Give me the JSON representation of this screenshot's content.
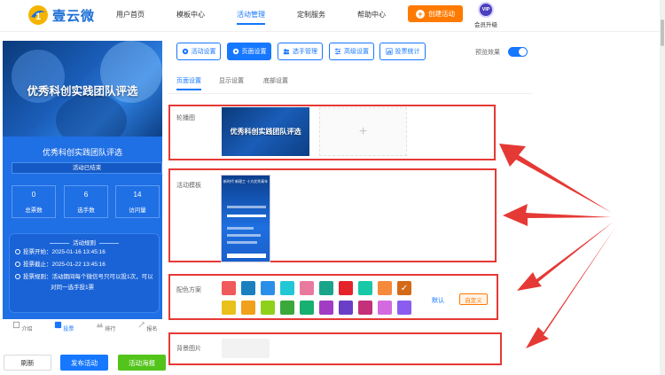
{
  "brand": {
    "name": "壹云微"
  },
  "nav": {
    "items": [
      {
        "label": "用户首页"
      },
      {
        "label": "模板中心"
      },
      {
        "label": "活动管理"
      },
      {
        "label": "定制服务"
      },
      {
        "label": "帮助中心"
      }
    ],
    "active_index": 2,
    "create_button": "创建活动",
    "vip_badge": "VIP",
    "vip_label": "会员升级"
  },
  "preview": {
    "banner_title": "优秀科创实践团队评选",
    "activity_title": "优秀科创实践团队评选",
    "status": "活动已结束",
    "stats": [
      {
        "value": "0",
        "label": "总票数"
      },
      {
        "value": "6",
        "label": "选手数"
      },
      {
        "value": "14",
        "label": "访问量"
      }
    ],
    "rules_heading": "活动规则",
    "rules": [
      "投票开始：2025-01-16 13:45:16",
      "投票截止：2025-01-22 13:45:16",
      "投票规则：活动期间每个微信号只可以投1次，可以",
      "对同一选手投1票"
    ],
    "bottom_tabs": [
      {
        "label": "介绍",
        "icon": "home-icon"
      },
      {
        "label": "投票",
        "icon": "vote-icon"
      },
      {
        "label": "排行",
        "icon": "rank-icon"
      },
      {
        "label": "报名",
        "icon": "signup-icon"
      }
    ],
    "active_tab": 1
  },
  "actions": {
    "refresh": "刷新",
    "publish": "发布活动",
    "poster": "活动海报"
  },
  "toolbar": {
    "tabs": [
      {
        "label": "活动设置",
        "icon": "gear-icon"
      },
      {
        "label": "页面设置",
        "icon": "gear-icon"
      },
      {
        "label": "选手管理",
        "icon": "users-icon"
      },
      {
        "label": "高级设置",
        "icon": "sliders-icon"
      },
      {
        "label": "投票统计",
        "icon": "bar-chart-icon"
      }
    ],
    "active_index": 1,
    "preview_label": "预览效果",
    "preview_on": true
  },
  "subtabs": {
    "items": [
      "页面设置",
      "显示设置",
      "底部设置"
    ],
    "active_index": 0
  },
  "sections": {
    "carousel_label": "轮播图",
    "carousel_image_title": "优秀科创实践团队评选",
    "add_symbol": "+",
    "template_label": "活动模板",
    "template_thumb_title": "新时代 新理工\n十大优秀青年",
    "color_label": "配色方案",
    "default_label": "默认",
    "custom_label": "自定义",
    "bg_label": "背景图片"
  },
  "colors": {
    "row1": [
      "#f05a5a",
      "#1a7fbf",
      "#2b8fe8",
      "#22c7d6",
      "#e87aa0",
      "#1aa38b",
      "#e5232a",
      "#17c9a6",
      "#f58a3c",
      "#d46a17"
    ],
    "row2": [
      "#e8c21a",
      "#f0a01a",
      "#8fd11a",
      "#3aa83a",
      "#17b070",
      "#a33cc4",
      "#6a3fc8",
      "#c4307a",
      "#d46ae0",
      "#8a5cf0"
    ],
    "selected": "#d46a17",
    "accent": "#1677ff",
    "annotation": "#e53935"
  }
}
